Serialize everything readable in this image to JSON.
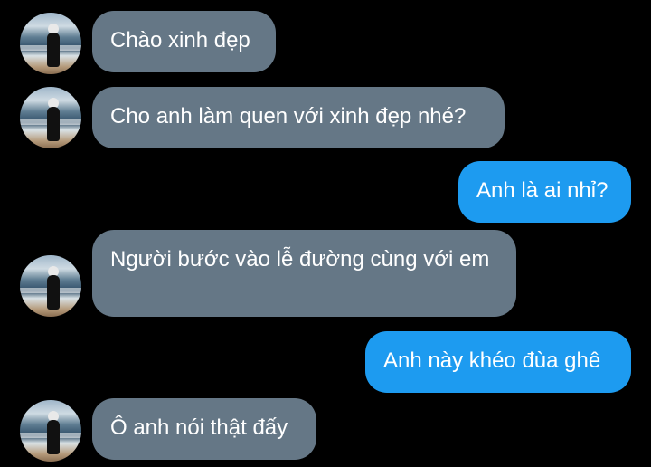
{
  "messages": [
    {
      "side": "incoming",
      "text": "Chào xinh đẹp"
    },
    {
      "side": "incoming",
      "text": "Cho anh làm quen với xinh đẹp nhé?"
    },
    {
      "side": "outgoing",
      "text": "Anh là ai nhỉ?"
    },
    {
      "side": "incoming",
      "text": "Người bước vào lễ đường cùng với em"
    },
    {
      "side": "outgoing",
      "text": "Anh này khéo đùa ghê"
    },
    {
      "side": "incoming",
      "text": "Ô anh nói thật đấy"
    }
  ],
  "colors": {
    "incoming_bubble": "#657786",
    "outgoing_bubble": "#1d9bf0",
    "background": "#000000"
  }
}
